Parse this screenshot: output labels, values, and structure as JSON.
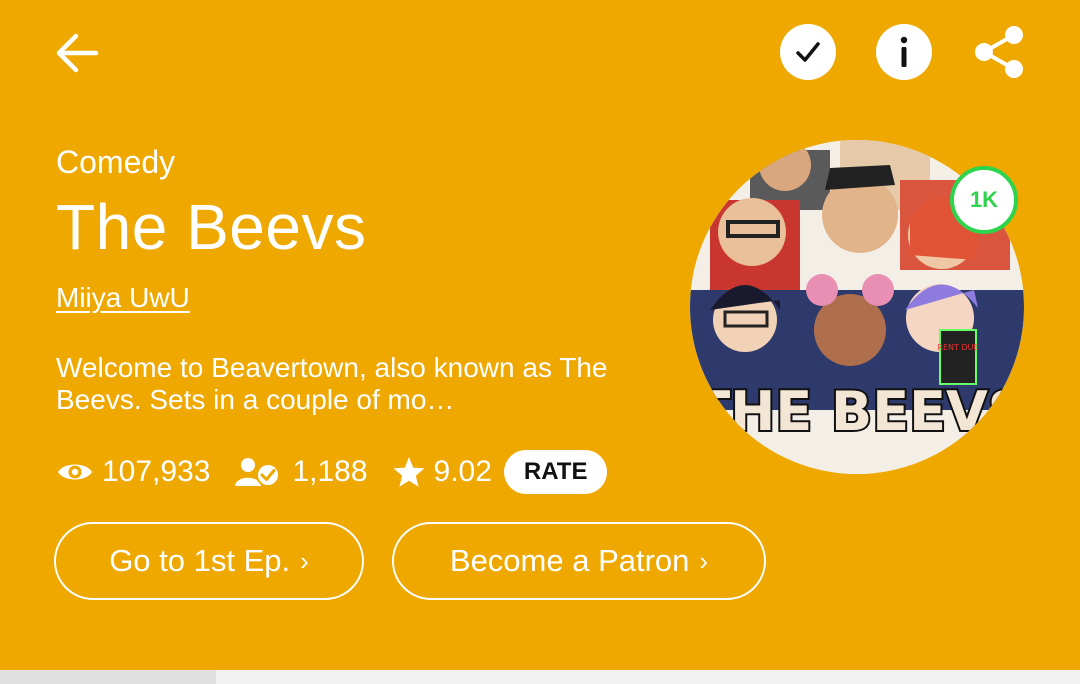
{
  "header": {
    "back_icon": "arrow-left-icon",
    "actions": [
      {
        "name": "subscribe",
        "icon": "check-icon"
      },
      {
        "name": "info",
        "icon": "info-icon"
      },
      {
        "name": "share",
        "icon": "share-icon"
      }
    ]
  },
  "series": {
    "genre": "Comedy",
    "title": "The Beevs",
    "author": "Miiya UwU",
    "synopsis": "Welcome to Beavertown, also known as The Beevs. Sets in a couple of mo…",
    "cover_text": "THE BEEVS",
    "cover_sign": "RENT DUE",
    "badge": "1K"
  },
  "stats": {
    "views": "107,933",
    "subscribers": "1,188",
    "rating": "9.02",
    "rate_label": "RATE"
  },
  "buttons": {
    "first_episode": "Go to 1st Ep.",
    "patron": "Become a Patron",
    "chevron": "›"
  },
  "colors": {
    "background": "#EEA800",
    "badge_accent": "#2ED44C",
    "text": "#FFFFFF"
  }
}
